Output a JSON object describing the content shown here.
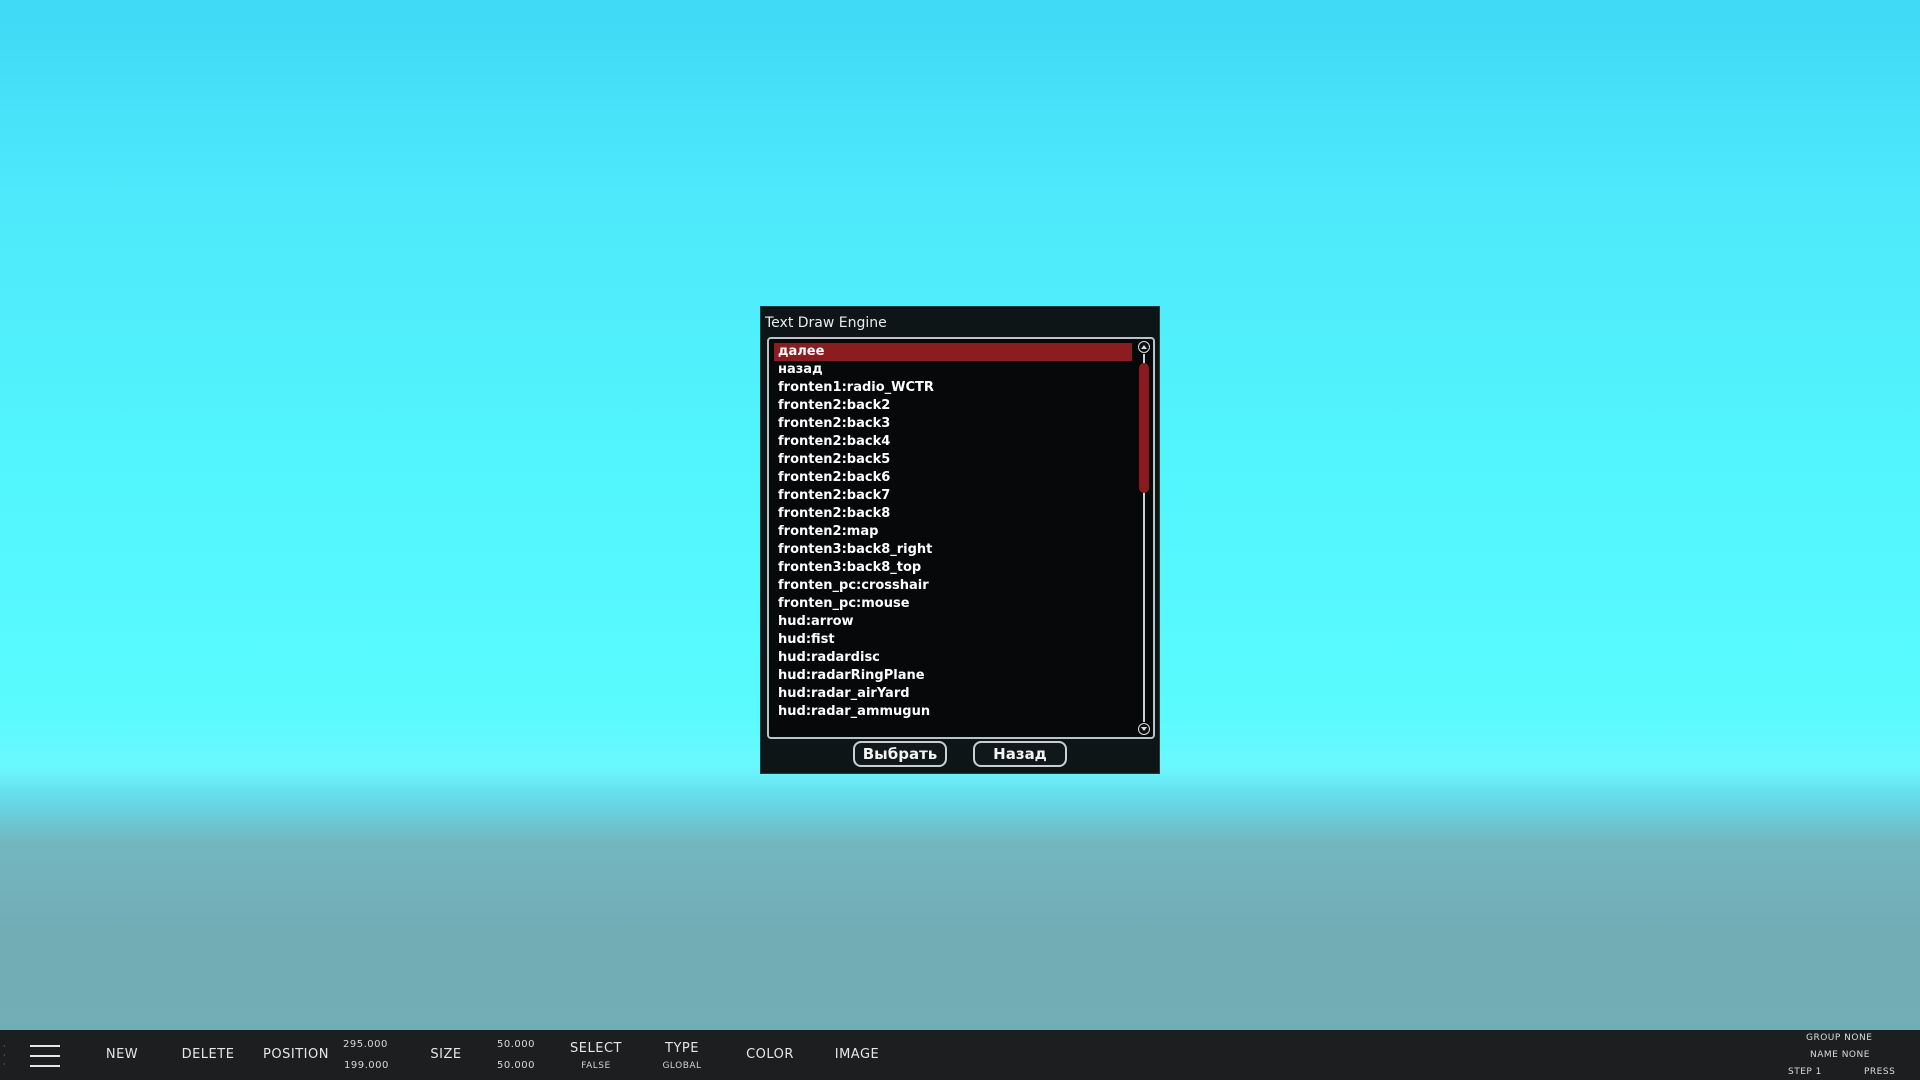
{
  "dialog": {
    "title": "Text Draw Engine",
    "items": [
      "далее",
      "назад",
      "fronten1:radio_WCTR",
      "fronten2:back2",
      "fronten2:back3",
      "fronten2:back4",
      "fronten2:back5",
      "fronten2:back6",
      "fronten2:back7",
      "fronten2:back8",
      "fronten2:map",
      "fronten3:back8_right",
      "fronten3:back8_top",
      "fronten_pc:crosshair",
      "fronten_pc:mouse",
      "hud:arrow",
      "hud:fist",
      "hud:radardisc",
      "hud:radarRingPlane",
      "hud:radar_airYard",
      "hud:radar_ammugun"
    ],
    "selected_item": "далее",
    "select_button": "Выбрать",
    "back_button": "Назад"
  },
  "toolbar": {
    "new": "NEW",
    "delete": "DELETE",
    "position": "POSITION",
    "position_x": "295.000",
    "position_y": "199.000",
    "size": "SIZE",
    "size_x": "50.000",
    "size_y": "50.000",
    "select": "SELECT",
    "select_value": "FALSE",
    "type": "TYPE",
    "type_value": "GLOBAL",
    "color": "COLOR",
    "image": "IMAGE",
    "group": "GROUP NONE",
    "name": "NAME NONE",
    "step": "STEP 1",
    "press": "PRESS"
  },
  "colors": {
    "selection": "#8b1c20",
    "dialog_bg": "#0d1517",
    "toolbar_bg": "#1c1e1f"
  }
}
